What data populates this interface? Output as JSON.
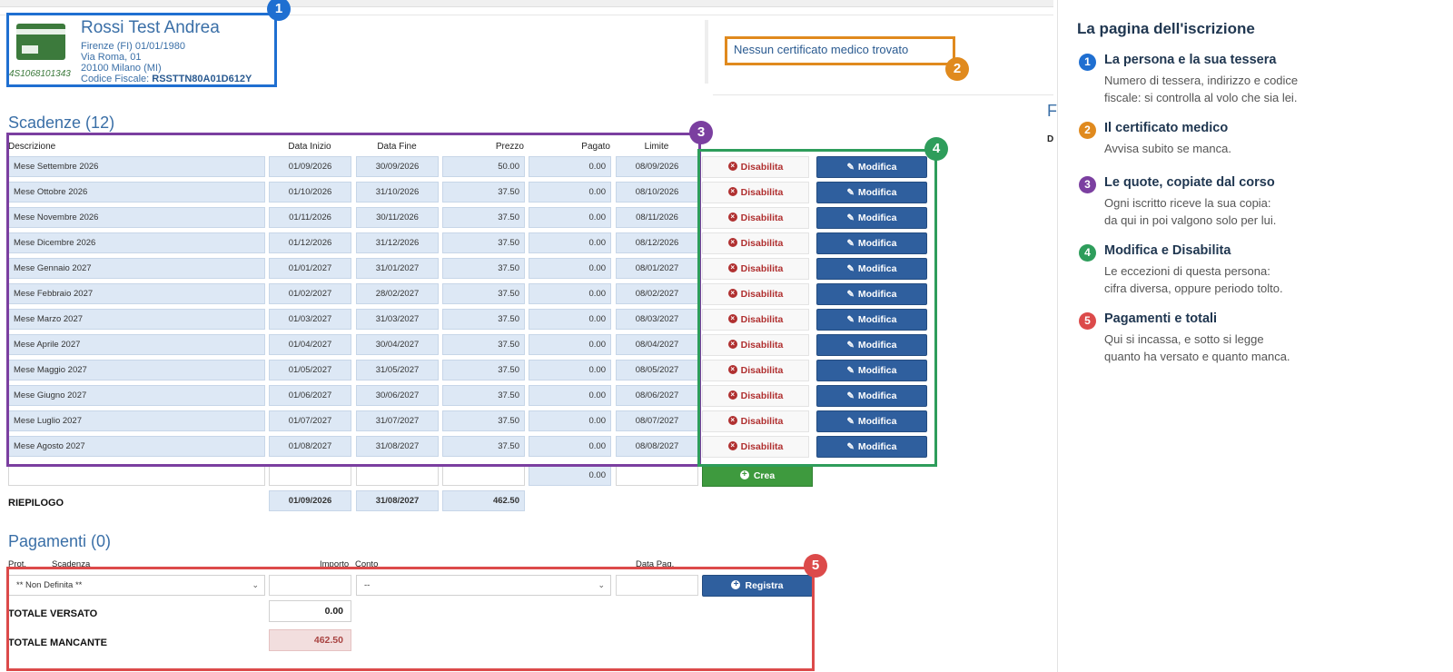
{
  "person": {
    "name": "Rossi Test Andrea",
    "birth": "Firenze (FI) 01/01/1980",
    "address1": "Via Roma, 01",
    "address2": "20100 Milano (MI)",
    "cf_label": "Codice Fiscale:",
    "cf_value": "RSSTTN80A01D612Y",
    "tessera": "4S1068101343"
  },
  "certificate": {
    "message": "Nessun certificato medico trovato"
  },
  "scadenze": {
    "title": "Scadenze (12)",
    "headers": {
      "descrizione": "Descrizione",
      "inizio": "Data Inizio",
      "fine": "Data Fine",
      "prezzo": "Prezzo",
      "pagato": "Pagato",
      "limite": "Limite"
    },
    "rows": [
      {
        "desc": "Mese Settembre 2026",
        "start": "01/09/2026",
        "end": "30/09/2026",
        "price": "50.00",
        "paid": "0.00",
        "limit": "08/09/2026"
      },
      {
        "desc": "Mese Ottobre 2026",
        "start": "01/10/2026",
        "end": "31/10/2026",
        "price": "37.50",
        "paid": "0.00",
        "limit": "08/10/2026"
      },
      {
        "desc": "Mese Novembre 2026",
        "start": "01/11/2026",
        "end": "30/11/2026",
        "price": "37.50",
        "paid": "0.00",
        "limit": "08/11/2026"
      },
      {
        "desc": "Mese Dicembre 2026",
        "start": "01/12/2026",
        "end": "31/12/2026",
        "price": "37.50",
        "paid": "0.00",
        "limit": "08/12/2026"
      },
      {
        "desc": "Mese Gennaio 2027",
        "start": "01/01/2027",
        "end": "31/01/2027",
        "price": "37.50",
        "paid": "0.00",
        "limit": "08/01/2027"
      },
      {
        "desc": "Mese Febbraio 2027",
        "start": "01/02/2027",
        "end": "28/02/2027",
        "price": "37.50",
        "paid": "0.00",
        "limit": "08/02/2027"
      },
      {
        "desc": "Mese Marzo 2027",
        "start": "01/03/2027",
        "end": "31/03/2027",
        "price": "37.50",
        "paid": "0.00",
        "limit": "08/03/2027"
      },
      {
        "desc": "Mese Aprile 2027",
        "start": "01/04/2027",
        "end": "30/04/2027",
        "price": "37.50",
        "paid": "0.00",
        "limit": "08/04/2027"
      },
      {
        "desc": "Mese Maggio 2027",
        "start": "01/05/2027",
        "end": "31/05/2027",
        "price": "37.50",
        "paid": "0.00",
        "limit": "08/05/2027"
      },
      {
        "desc": "Mese Giugno 2027",
        "start": "01/06/2027",
        "end": "30/06/2027",
        "price": "37.50",
        "paid": "0.00",
        "limit": "08/06/2027"
      },
      {
        "desc": "Mese Luglio 2027",
        "start": "01/07/2027",
        "end": "31/07/2027",
        "price": "37.50",
        "paid": "0.00",
        "limit": "08/07/2027"
      },
      {
        "desc": "Mese Agosto 2027",
        "start": "01/08/2027",
        "end": "31/08/2027",
        "price": "37.50",
        "paid": "0.00",
        "limit": "08/08/2027"
      }
    ],
    "disable_label": "Disabilita",
    "edit_label": "Modifica",
    "new_row": {
      "paid": "0.00",
      "create_label": "Crea"
    },
    "summary": {
      "label": "RIEPILOGO",
      "start": "01/09/2026",
      "end": "31/08/2027",
      "price": "462.50"
    }
  },
  "pagamenti": {
    "title": "Pagamenti (0)",
    "headers": {
      "prot": "Prot.",
      "scadenza": "Scadenza",
      "importo": "Importo",
      "conto": "Conto",
      "data": "Data Pag."
    },
    "scadenza_value": "** Non Definita **",
    "conto_value": "--",
    "register_label": "Registra",
    "tot_versato_label": "TOTALE VERSATO",
    "tot_versato_value": "0.00",
    "tot_mancante_label": "TOTALE MANCANTE",
    "tot_mancante_value": "462.50"
  },
  "guide": {
    "title": "La pagina dell'iscrizione",
    "items": [
      {
        "num": "1",
        "title": "La persona e la sua tessera",
        "line1": "Numero di tessera, indirizzo e codice",
        "line2": "fiscale: si controlla al volo che sia lei.",
        "color": "#1f6fd1"
      },
      {
        "num": "2",
        "title": "Il certificato medico",
        "line1": "Avvisa subito se manca.",
        "line2": "",
        "color": "#e08a1e"
      },
      {
        "num": "3",
        "title": "Le quote, copiate dal corso",
        "line1": "Ogni iscritto riceve la sua copia:",
        "line2": "da qui in poi valgono solo per lui.",
        "color": "#7b3fa0"
      },
      {
        "num": "4",
        "title": "Modifica e Disabilita",
        "line1": "Le eccezioni di questa persona:",
        "line2": "cifra diversa, oppure periodo tolto.",
        "color": "#2e9d5b"
      },
      {
        "num": "5",
        "title": "Pagamenti e totali",
        "line1": "Qui si incassa, e sotto si legge",
        "line2": "quanto ha versato e quanto manca.",
        "color": "#dc4a4a"
      }
    ]
  },
  "annotations": {
    "b1": "1",
    "b2": "2",
    "b3": "3",
    "b4": "4",
    "b5": "5",
    "colors": {
      "blue": "#1f6fd1",
      "orange": "#e08a1e",
      "purple": "#7b3fa0",
      "green": "#2e9d5b",
      "red": "#dc4a4a"
    }
  },
  "cutoff": {
    "f": "F",
    "d": "D"
  }
}
